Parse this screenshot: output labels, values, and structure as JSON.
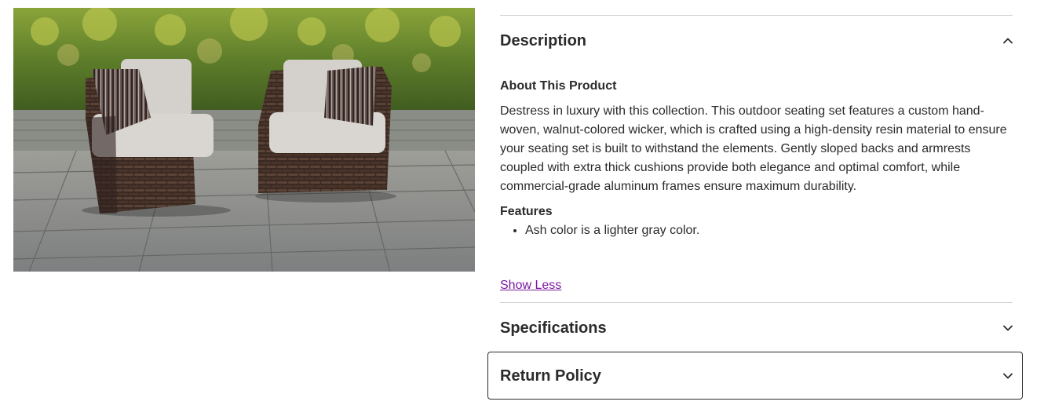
{
  "product_image": {
    "alt": "Two wicker outdoor lounge chairs with light gray cushions and striped pillows on a stone patio",
    "icon": "product-photo"
  },
  "description": {
    "title": "Description",
    "expanded": true,
    "about_heading": "About This Product",
    "about_text": "Destress in luxury with this collection. This outdoor seating set features a custom hand-woven, walnut-colored wicker, which is crafted using a high-density resin material to ensure your seating set is built to withstand the elements. Gently sloped backs and armrests coupled with extra thick cushions provide both elegance and optimal comfort, while commercial-grade aluminum frames ensure maximum durability.",
    "features_heading": "Features",
    "features": [
      "Ash color is a lighter gray color."
    ],
    "show_less_label": "Show Less"
  },
  "specifications": {
    "title": "Specifications",
    "expanded": false
  },
  "return_policy": {
    "title": "Return Policy",
    "expanded": false
  },
  "colors": {
    "link": "#7b189f",
    "text": "#2b2b2b",
    "divider": "#cfcfcf"
  }
}
